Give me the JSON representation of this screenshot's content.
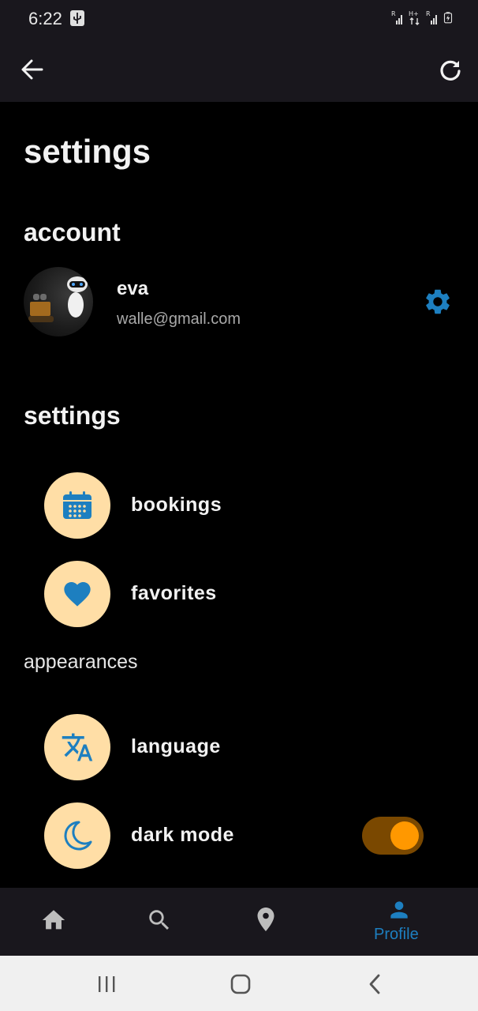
{
  "status_bar": {
    "time": "6:22"
  },
  "page": {
    "title": "settings"
  },
  "account": {
    "section_title": "account",
    "name": "eva",
    "email": "walle@gmail.com"
  },
  "settings": {
    "section_title": "settings",
    "items": [
      {
        "label": "bookings",
        "icon": "calendar-icon"
      },
      {
        "label": "favorites",
        "icon": "heart-icon"
      }
    ]
  },
  "appearances": {
    "section_title": "appearances",
    "items": [
      {
        "label": "language",
        "icon": "translate-icon"
      },
      {
        "label": "dark mode",
        "icon": "moon-icon",
        "toggle_on": true
      }
    ]
  },
  "bottom_nav": {
    "items": [
      {
        "icon": "home-icon",
        "label": ""
      },
      {
        "icon": "search-icon",
        "label": ""
      },
      {
        "icon": "location-pin-icon",
        "label": ""
      },
      {
        "icon": "person-icon",
        "label": "Profile",
        "active": true
      }
    ]
  },
  "colors": {
    "accent": "#1d7fc0",
    "icon_circle": "#ffdea6",
    "toggle_track": "#7a4800",
    "toggle_knob": "#ff9800",
    "bar_background": "#19171d"
  }
}
